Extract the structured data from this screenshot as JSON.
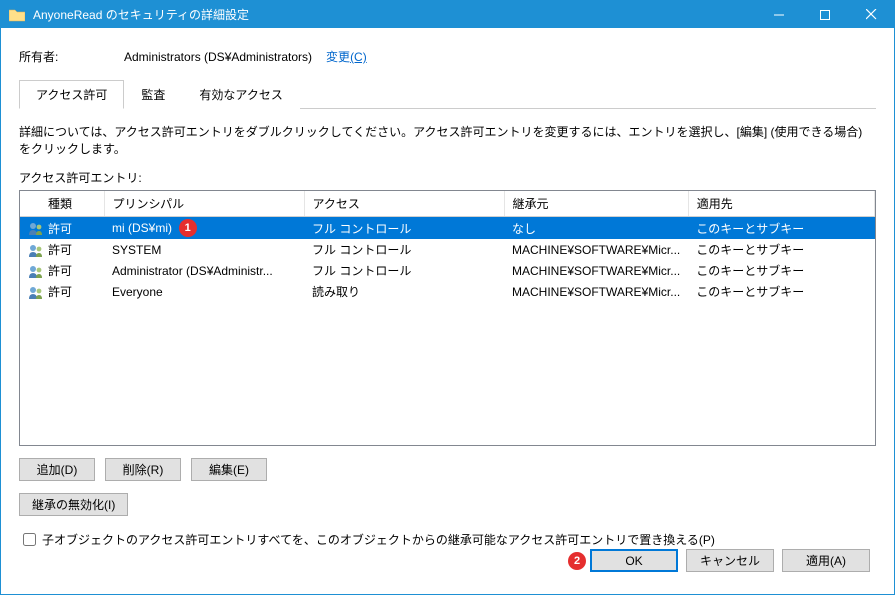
{
  "title": "AnyoneRead のセキュリティの詳細設定",
  "owner": {
    "label": "所有者:",
    "value": "Administrators (DS¥Administrators)",
    "change_link_prefix": "変更",
    "change_link_key": "(C)"
  },
  "tabs": [
    "アクセス許可",
    "監査",
    "有効なアクセス"
  ],
  "active_tab": 0,
  "instructions": "詳細については、アクセス許可エントリをダブルクリックしてください。アクセス許可エントリを変更するには、エントリを選択し、[編集] (使用できる場合) をクリックします。",
  "entries_label": "アクセス許可エントリ:",
  "columns": {
    "type": "種類",
    "principal": "プリンシパル",
    "access": "アクセス",
    "inherited": "継承元",
    "applies": "適用先"
  },
  "rows": [
    {
      "icon": "user",
      "type": "許可",
      "principal": "mi (DS¥mi)",
      "access": "フル コントロール",
      "inherited": "なし",
      "applies": "このキーとサブキー",
      "selected": true,
      "badge": "1"
    },
    {
      "icon": "users",
      "type": "許可",
      "principal": "SYSTEM",
      "access": "フル コントロール",
      "inherited": "MACHINE¥SOFTWARE¥Micr...",
      "applies": "このキーとサブキー"
    },
    {
      "icon": "user",
      "type": "許可",
      "principal": "Administrator (DS¥Administr...",
      "access": "フル コントロール",
      "inherited": "MACHINE¥SOFTWARE¥Micr...",
      "applies": "このキーとサブキー"
    },
    {
      "icon": "users",
      "type": "許可",
      "principal": "Everyone",
      "access": "読み取り",
      "inherited": "MACHINE¥SOFTWARE¥Micr...",
      "applies": "このキーとサブキー"
    }
  ],
  "buttons": {
    "add": "追加(D)",
    "remove": "削除(R)",
    "edit": "編集(E)",
    "disable_inherit": "継承の無効化(I)"
  },
  "checkbox_label": "子オブジェクトのアクセス許可エントリすべてを、このオブジェクトからの継承可能なアクセス許可エントリで置き換える(P)",
  "footer": {
    "ok": "OK",
    "cancel": "キャンセル",
    "apply": "適用(A)",
    "ok_badge": "2"
  }
}
